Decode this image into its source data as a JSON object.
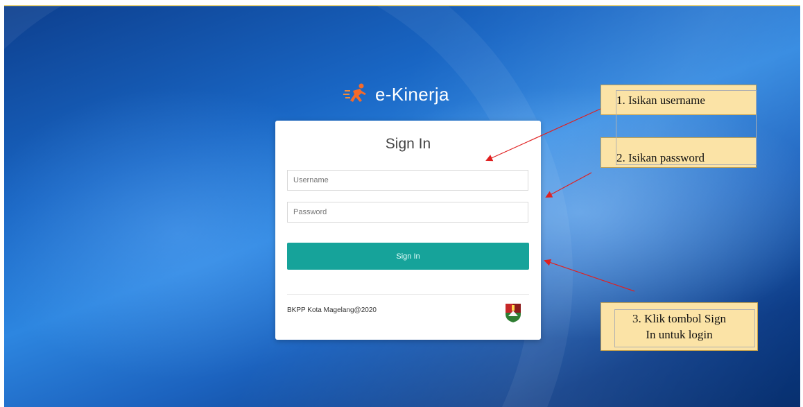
{
  "app": {
    "logo_text": "e-Kinerja",
    "logo_icon": "runner-icon"
  },
  "login": {
    "title": "Sign In",
    "username_placeholder": "Username",
    "password_placeholder": "Password",
    "submit_label": "Sign In",
    "footer": "BKPP Kota Magelang@2020",
    "crest_icon": "city-crest-icon"
  },
  "annotations": {
    "step1": "1. Isikan username",
    "step2": "2. Isikan password",
    "step3_line1": "3. Klik tombol Sign",
    "step3_line2": "In untuk login"
  },
  "colors": {
    "button": "#16a39a",
    "note_fill": "#fbe3a6",
    "arrow": "#e02020"
  }
}
